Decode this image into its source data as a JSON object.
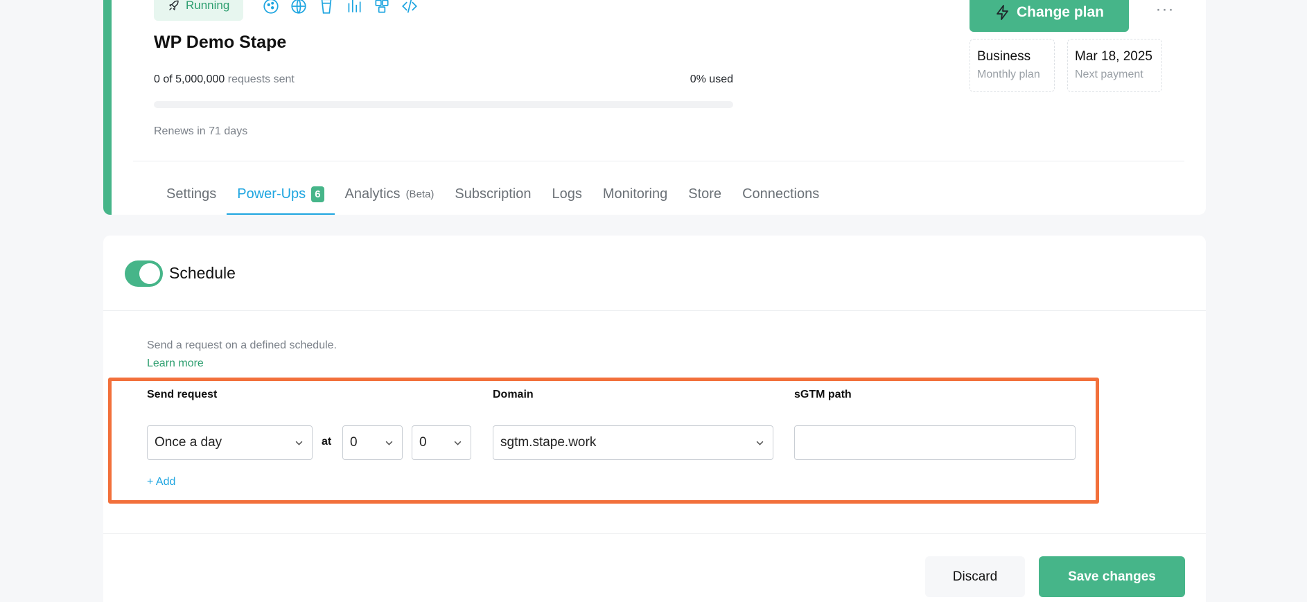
{
  "container": {
    "status": "Running",
    "title": "WP Demo Stape",
    "requests_count": "0 of 5,000,000",
    "requests_suffix": "requests sent",
    "used_label": "0% used",
    "used_fraction": 0,
    "renews": "Renews in 71 days",
    "feature_icons": [
      "cookie-icon",
      "globe-icon",
      "cup-icon",
      "signal-bars-icon",
      "puzzle-icon",
      "code-icon"
    ]
  },
  "plan": {
    "change_plan_label": "Change plan",
    "more_label": "···",
    "plan_name": "Business",
    "plan_period": "Monthly plan",
    "next_payment_date": "Mar 18, 2025",
    "next_payment_label": "Next payment"
  },
  "tabs": [
    {
      "label": "Settings"
    },
    {
      "label": "Power-Ups",
      "count": "6"
    },
    {
      "label": "Analytics",
      "suffix": "(Beta)"
    },
    {
      "label": "Subscription"
    },
    {
      "label": "Logs"
    },
    {
      "label": "Monitoring"
    },
    {
      "label": "Store"
    },
    {
      "label": "Connections"
    }
  ],
  "schedule": {
    "title": "Schedule",
    "enabled": true,
    "description": "Send a request on a defined schedule.",
    "learn_more": "Learn more",
    "send_request_label": "Send request",
    "send_request_value": "Once a day",
    "at_label": "at",
    "hour_value": "0",
    "minute_value": "0",
    "domain_label": "Domain",
    "domain_value": "sgtm.stape.work",
    "path_label": "sGTM path",
    "path_value": "",
    "add_label": "+ Add"
  },
  "footer": {
    "discard_label": "Discard",
    "save_label": "Save changes"
  },
  "colors": {
    "accent_green": "#46b589",
    "active_tab_blue": "#1ea5e0",
    "highlight_orange": "#f2703b"
  }
}
